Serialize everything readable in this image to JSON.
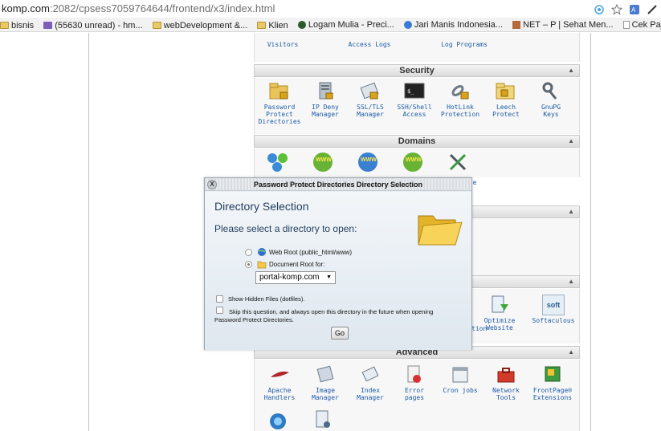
{
  "browser": {
    "url_host": "komp.com",
    "url_path": ":2082/cpsess7059764644/frontend/x3/index.html",
    "bookmarks": [
      {
        "label": "bisnis",
        "icon": "folder-icon"
      },
      {
        "label": "(55630 unread) - hm...",
        "icon": "mail-icon"
      },
      {
        "label": "webDevelopment &...",
        "icon": "folder-icon"
      },
      {
        "label": "Klien",
        "icon": "folder-icon"
      },
      {
        "label": "Logam Mulia - Preci...",
        "icon": "site-icon"
      },
      {
        "label": "Jari Manis Indonesia...",
        "icon": "site-icon"
      },
      {
        "label": "NET – P | Sehat Men...",
        "icon": "site-icon"
      },
      {
        "label": "Cek Pajak Kendaraan",
        "icon": "page-icon"
      }
    ]
  },
  "top_row": {
    "items": [
      "Visitors",
      "Access Logs",
      "Log Programs"
    ]
  },
  "security": {
    "title": "Security",
    "items": [
      {
        "l1": "Password",
        "l2": "Protect",
        "l3": "Directories"
      },
      {
        "l1": "IP Deny",
        "l2": "Manager",
        "l3": ""
      },
      {
        "l1": "SSL/TLS",
        "l2": "Manager",
        "l3": ""
      },
      {
        "l1": "SSH/Shell",
        "l2": "Access",
        "l3": ""
      },
      {
        "l1": "HotLink",
        "l2": "Protection",
        "l3": ""
      },
      {
        "l1": "Leech",
        "l2": "Protect",
        "l3": ""
      },
      {
        "l1": "GnuPG",
        "l2": "Keys",
        "l3": ""
      }
    ]
  },
  "domains": {
    "title": "Domains",
    "partial_label": "e"
  },
  "software": {
    "items": [
      {
        "l1": "Optimize",
        "l2": "Website"
      },
      {
        "l1": "Softaculous",
        "l2": ""
      }
    ],
    "partial_label": "tion",
    "softaculous_badge": "soft"
  },
  "advanced": {
    "title": "Advanced",
    "items": [
      {
        "l1": "Apache",
        "l2": "Handlers"
      },
      {
        "l1": "Image",
        "l2": "Manager"
      },
      {
        "l1": "Index",
        "l2": "Manager"
      },
      {
        "l1": "Error",
        "l2": "pages"
      },
      {
        "l1": "Cron jobs",
        "l2": ""
      },
      {
        "l1": "Network",
        "l2": "Tools"
      },
      {
        "l1": "FrontPage®",
        "l2": "Extensions"
      }
    ]
  },
  "dialog": {
    "title": "Password Protect Directories Directory Selection",
    "close": "X",
    "heading": "Directory Selection",
    "prompt": "Please select a directory to open:",
    "option_webroot": "Web Root (public_html/www)",
    "option_docroot": "Document Root for:",
    "selected_domain": "portal-komp.com",
    "show_hidden": "Show Hidden Files (dotfiles).",
    "skip_text": "Skip this question, and always open this directory in the future when opening Password Protect Directories.",
    "go_label": "Go"
  }
}
